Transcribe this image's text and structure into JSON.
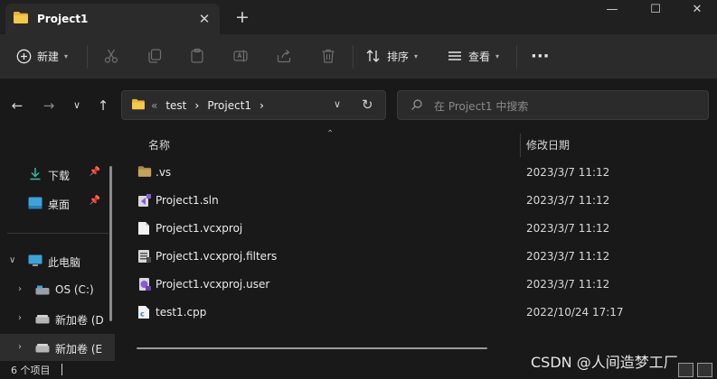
{
  "tab": {
    "title": "Project1",
    "close": "✕",
    "new_tab": "+"
  },
  "window_controls": {
    "minimize": "—",
    "maximize": "☐",
    "close": "✕"
  },
  "toolbar": {
    "new_label": "新建",
    "sort_label": "排序",
    "view_label": "查看",
    "more_label": "···",
    "disabled_icons": [
      "cut-icon",
      "copy-icon",
      "paste-icon",
      "rename-icon",
      "share-icon",
      "delete-icon"
    ]
  },
  "address": {
    "overflow": "«",
    "crumbs": [
      "test",
      "Project1"
    ],
    "separator": "›"
  },
  "search": {
    "placeholder": "在 Project1 中搜索"
  },
  "sidebar": {
    "quick": [
      {
        "label": "下载",
        "icon": "download-icon"
      },
      {
        "label": "桌面",
        "icon": "desktop-icon"
      }
    ],
    "this_pc": "此电脑",
    "drives": [
      {
        "label": "OS (C:)",
        "icon": "drive-icon"
      },
      {
        "label": "新加卷 (D",
        "icon": "drive-icon"
      },
      {
        "label": "新加卷 (E",
        "icon": "drive-icon"
      }
    ]
  },
  "columns": {
    "name": "名称",
    "modified": "修改日期"
  },
  "files": [
    {
      "name": ".vs",
      "modified": "2023/3/7 11:12",
      "icon": "folder-icon"
    },
    {
      "name": "Project1.sln",
      "modified": "2023/3/7 11:12",
      "icon": "vs-solution-icon"
    },
    {
      "name": "Project1.vcxproj",
      "modified": "2023/3/7 11:12",
      "icon": "file-icon"
    },
    {
      "name": "Project1.vcxproj.filters",
      "modified": "2023/3/7 11:12",
      "icon": "filters-file-icon"
    },
    {
      "name": "Project1.vcxproj.user",
      "modified": "2023/3/7 11:12",
      "icon": "user-file-icon"
    },
    {
      "name": "test1.cpp",
      "modified": "2022/10/24 17:17",
      "icon": "cpp-file-icon"
    }
  ],
  "status": {
    "item_count": "6 个项目"
  },
  "watermark": "CSDN @人间造梦工厂",
  "colors": {
    "folder": "#e8b53a",
    "background": "#191919",
    "toolbar": "#2b2b2b"
  }
}
